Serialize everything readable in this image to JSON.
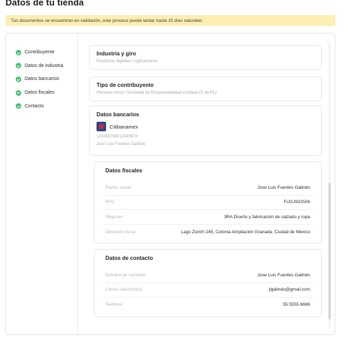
{
  "page": {
    "title": "Datos de tu tienda",
    "banner": "Tus documentos se encuentran en validación, este proceso puede tardar hasta 15 días naturales"
  },
  "nav": {
    "items": [
      {
        "label": "Contribuyente"
      },
      {
        "label": "Datos de industria"
      },
      {
        "label": "Datos bancarios"
      },
      {
        "label": "Datos fiscales"
      },
      {
        "label": "Contacto"
      }
    ]
  },
  "industria": {
    "title": "Industria y giro",
    "subtitle": "Productos digitales  •  Aplicaciones"
  },
  "tipo": {
    "title": "Tipo de contribuyente",
    "subtitle": "Persona moral  •  Sociedad de Responsabilidad Limitada (S de RL)"
  },
  "bancarios": {
    "title": "Datos bancarios",
    "bank_name": "Citibanamex",
    "account": "123456789012345678",
    "holder": "Jose Luis Fuentes Galindo"
  },
  "fiscales": {
    "title": "Datos fiscales",
    "rows": [
      {
        "label": "Razón social",
        "value": "Jose Luis Fuentes Galindo"
      },
      {
        "label": "RFC",
        "value": "FUGJ932506"
      },
      {
        "label": "Régimen",
        "value": "3RA Diseño y fabricación de calzado y ropa"
      },
      {
        "label": "Dirección fiscal",
        "value": "Lago Zúrich 245, Colonia Ampliación Granada, Ciudad de México"
      }
    ]
  },
  "contacto": {
    "title": "Datos de contacto",
    "rows": [
      {
        "label": "Nombre de contacto",
        "value": "Jose Luis Fuentes Galindo"
      },
      {
        "label": "Correo electrónico",
        "value": "jlgalindo@gmail.com"
      },
      {
        "label": "Teléfono",
        "value": "55 5555 6666"
      }
    ]
  },
  "colors": {
    "banner_bg": "#fdeeb3",
    "check_green": "#3fbf72",
    "bank_logo_blue": "#1f4b8f",
    "bank_logo_red": "#d2263b"
  },
  "icons": {
    "nav_status": "check-circle-icon",
    "bank": "citibanamex-logo"
  }
}
